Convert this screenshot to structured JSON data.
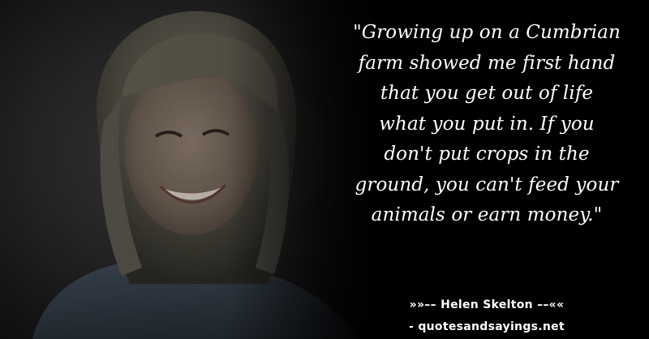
{
  "quote": {
    "lines": [
      "\"Growing up on a Cumbrian",
      "farm showed me first hand",
      "that you get out of life",
      "what you put in. If you",
      "don't put crops in the",
      "ground, you can't feed your",
      "animals or earn money.\""
    ]
  },
  "author": "»»–– Helen Skelton ––««",
  "source": "- quotesandsayings.net",
  "colors": {
    "background": "#000000",
    "text": "#ffffff"
  }
}
